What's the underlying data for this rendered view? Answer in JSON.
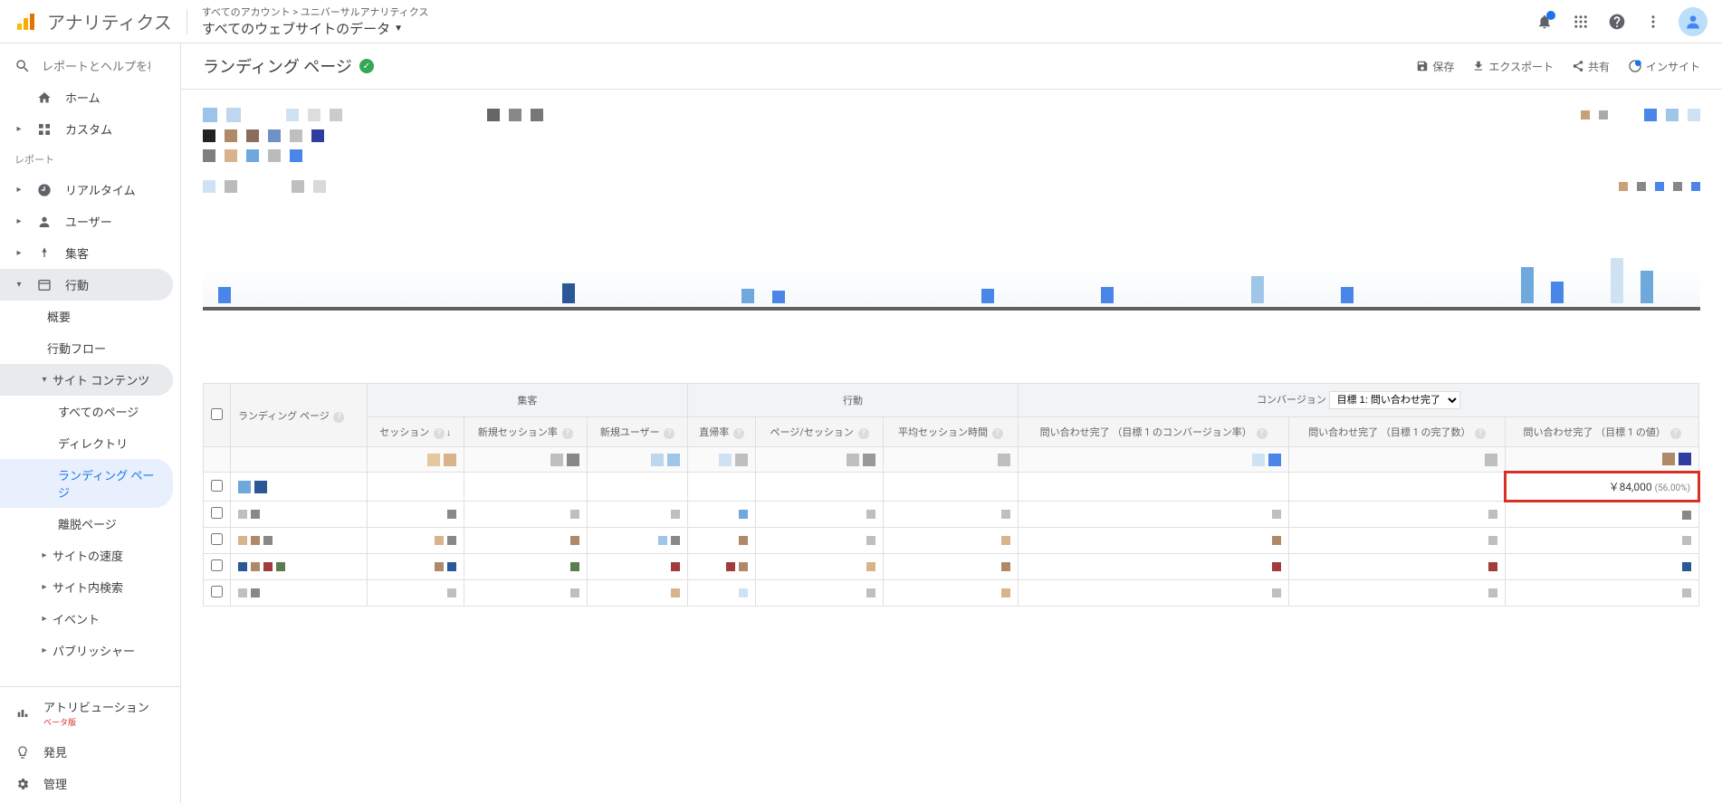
{
  "header": {
    "product": "アナリティクス",
    "breadcrumb_top": "すべてのアカウント > ユニバーサルアナリティクス",
    "breadcrumb_bottom": "すべてのウェブサイトのデータ"
  },
  "sidebar": {
    "search_placeholder": "レポートとヘルプを検索",
    "home": "ホーム",
    "custom": "カスタム",
    "reports_label": "レポート",
    "realtime": "リアルタイム",
    "user": "ユーザー",
    "acquisition": "集客",
    "behavior": "行動",
    "overview": "概要",
    "behavior_flow": "行動フロー",
    "site_content": "サイト コンテンツ",
    "all_pages": "すべてのページ",
    "directory": "ディレクトリ",
    "landing_pages": "ランディング ページ",
    "exit_pages": "離脱ページ",
    "site_speed": "サイトの速度",
    "site_search": "サイト内検索",
    "events": "イベント",
    "publisher": "パブリッシャー",
    "attribution": "アトリビューション",
    "beta": "ベータ版",
    "discover": "発見",
    "admin": "管理"
  },
  "page": {
    "title": "ランディング ページ",
    "save": "保存",
    "export": "エクスポート",
    "share": "共有",
    "insights": "インサイト"
  },
  "table": {
    "landing_page": "ランディング ページ",
    "acquisition": "集客",
    "behavior": "行動",
    "conversion": "コンバージョン",
    "conv_goal": "目標 1: 問い合わせ完了",
    "sessions": "セッション",
    "new_session_rate": "新規セッション率",
    "new_users": "新規ユーザー",
    "bounce_rate": "直帰率",
    "pages_per_session": "ページ/セッション",
    "avg_session_duration": "平均セッション時間",
    "goal_conv_rate": "問い合わせ完了 （目標 1 のコンバージョン率）",
    "goal_completions": "問い合わせ完了 （目標 1 の完了数）",
    "goal_value": "問い合わせ完了 （目標 1 の値）",
    "highlight_value": "￥84,000",
    "highlight_pct": "(56.00%)"
  }
}
